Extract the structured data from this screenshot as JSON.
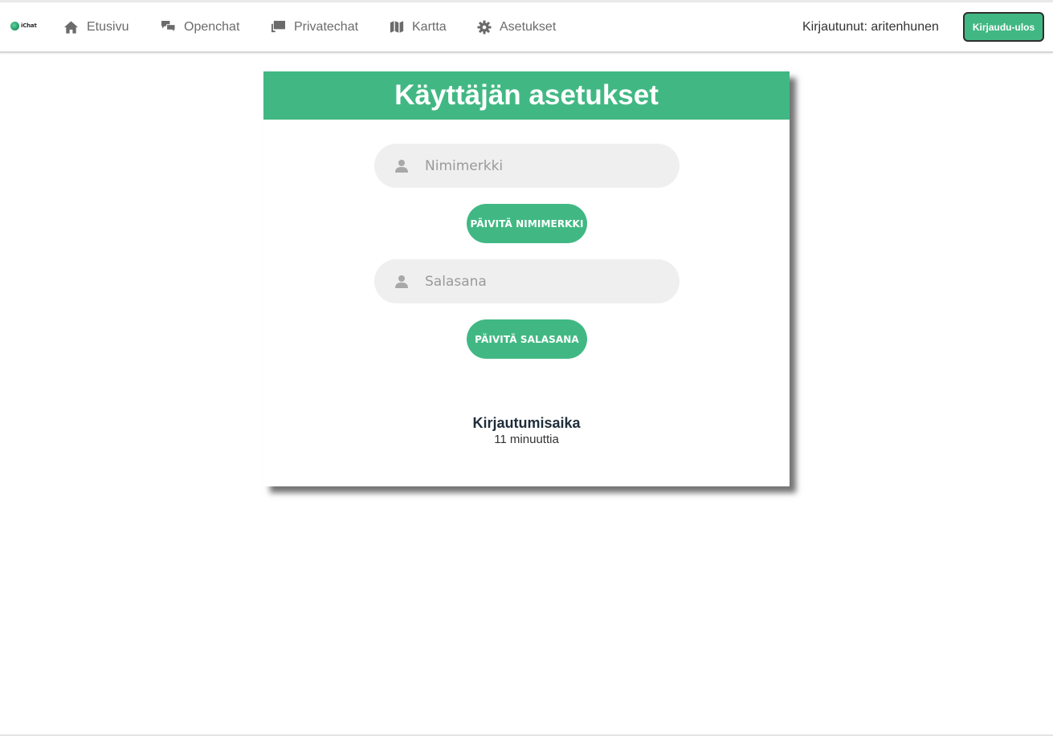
{
  "app": {
    "logo_text": "iChat"
  },
  "nav": {
    "items": [
      {
        "label": "Etusivu",
        "icon": "home-icon"
      },
      {
        "label": "Openchat",
        "icon": "chat-bubbles-icon"
      },
      {
        "label": "Privatechat",
        "icon": "message-icon"
      },
      {
        "label": "Kartta",
        "icon": "map-icon"
      },
      {
        "label": "Asetukset",
        "icon": "gear-icon"
      }
    ],
    "user_status": "Kirjautunut: aritenhunen",
    "logout_label": "Kirjaudu-ulos"
  },
  "settings": {
    "title": "Käyttäjän asetukset",
    "nickname": {
      "placeholder": "Nimimerkki",
      "value": "",
      "button_label": "PÄIVITÄ NIMIMERKKI"
    },
    "password": {
      "placeholder": "Salasana",
      "value": "",
      "button_label": "PÄIVITÄ SALASANA"
    },
    "session": {
      "label": "Kirjautumisaika",
      "value": "11 minuuttia"
    }
  },
  "colors": {
    "accent": "#41b883",
    "nav_text": "#6b6b6b",
    "input_bg": "#efefef"
  }
}
